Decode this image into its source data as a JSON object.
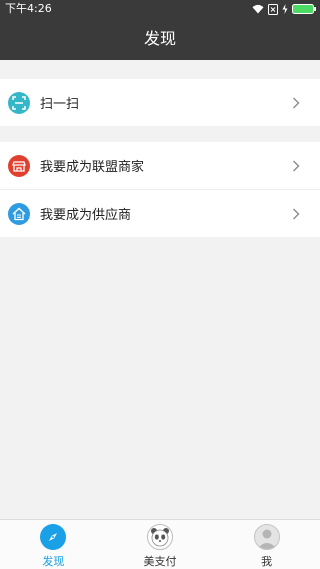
{
  "status_bar": {
    "time": "下午4:26"
  },
  "header": {
    "title": "发现"
  },
  "groups": [
    {
      "items": [
        {
          "label": "扫一扫",
          "icon": "scan-icon",
          "color": "#36b7c8"
        }
      ]
    },
    {
      "items": [
        {
          "label": "我要成为联盟商家",
          "icon": "shop-icon",
          "color": "#e0402e"
        },
        {
          "label": "我要成为供应商",
          "icon": "supplier-home-icon",
          "color": "#2f9be0"
        }
      ]
    }
  ],
  "tabs": [
    {
      "label": "发现",
      "icon": "compass-icon",
      "active": true,
      "color": "#1aa0e6"
    },
    {
      "label": "美支付",
      "icon": "panda-icon",
      "active": false
    },
    {
      "label": "我",
      "icon": "user-avatar-icon",
      "active": false
    }
  ]
}
